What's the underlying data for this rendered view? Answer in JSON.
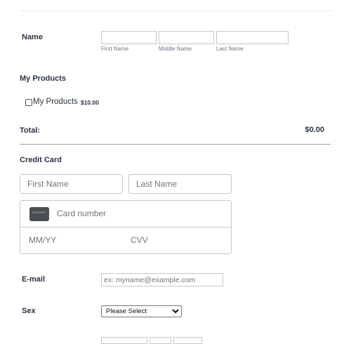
{
  "name": {
    "label": "Name",
    "first_sub": "First Name",
    "middle_sub": "Middle Name",
    "last_sub": "Last Name",
    "first_value": "",
    "middle_value": "",
    "last_value": ""
  },
  "products": {
    "section_label": "My Products",
    "item_label": "My Products",
    "item_price": "$10.00",
    "checked": false
  },
  "total": {
    "label": "Total:",
    "value": "$0.00"
  },
  "credit_card": {
    "section_label": "Credit Card",
    "first_name_placeholder": "First Name",
    "last_name_placeholder": "Last Name",
    "card_number_placeholder": "Card number",
    "expiry_placeholder": "MM/YY",
    "cvv_placeholder": "CVV",
    "card_icon": "credit-card-icon"
  },
  "email": {
    "label": "E-mail",
    "placeholder": "ex: myname@example.com"
  },
  "sex": {
    "label": "Sex",
    "selected": "Please Select"
  },
  "colors": {
    "text": "#2c3345",
    "border": "#c3c7cf",
    "divider": "#9aa0aa",
    "card_icon": "#4a4d52"
  }
}
